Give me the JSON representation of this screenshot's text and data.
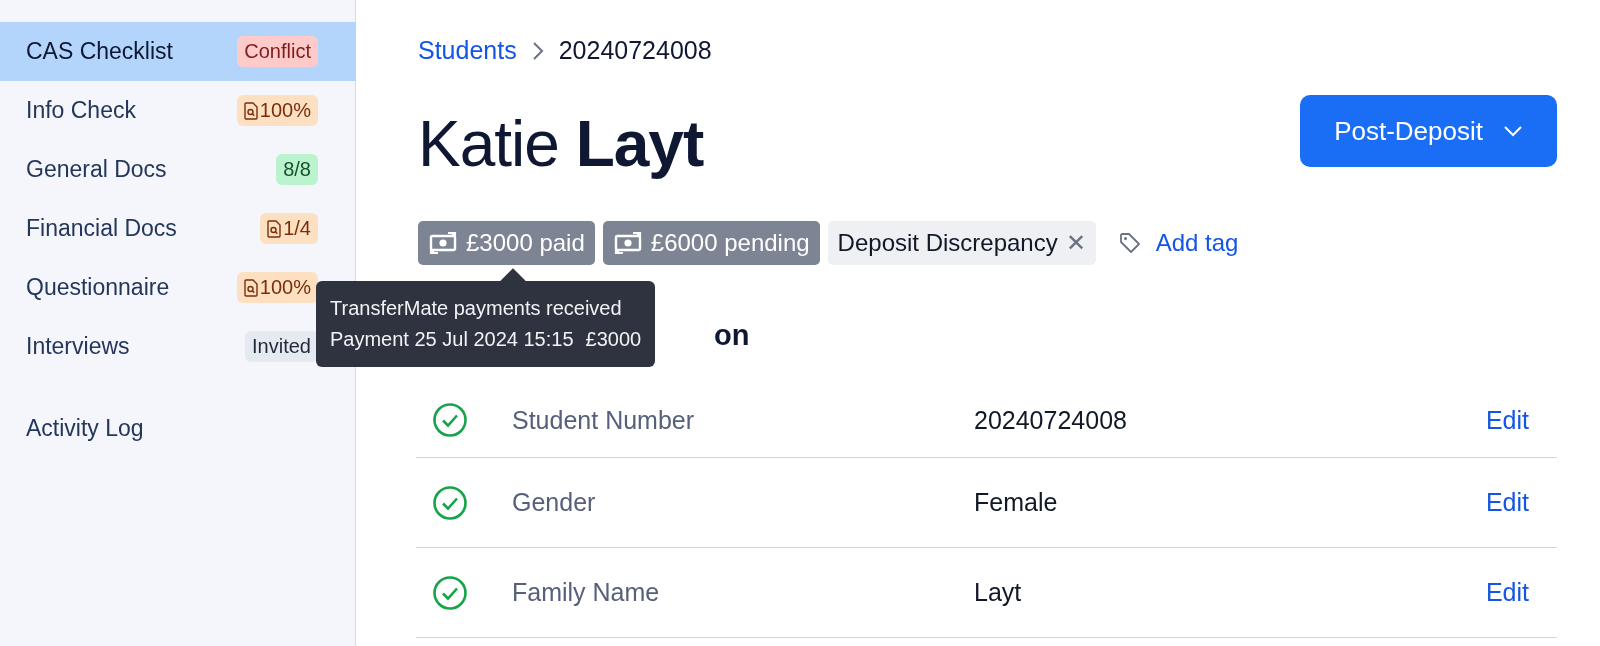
{
  "sidebar": {
    "items": [
      {
        "label": "CAS Checklist",
        "selected": true,
        "badge": {
          "kind": "danger",
          "text": "Conflict"
        }
      },
      {
        "label": "Info Check",
        "selected": false,
        "badge": {
          "kind": "warning_doc",
          "text": "100%"
        }
      },
      {
        "label": "General Docs",
        "selected": false,
        "badge": {
          "kind": "success",
          "text": "8/8"
        }
      },
      {
        "label": "Financial Docs",
        "selected": false,
        "badge": {
          "kind": "warning_doc",
          "text": "1/4"
        }
      },
      {
        "label": "Questionnaire",
        "selected": false,
        "badge": {
          "kind": "warning_doc",
          "text": "100%"
        }
      },
      {
        "label": "Interviews",
        "selected": false,
        "badge": {
          "kind": "neutral",
          "text": "Invited"
        }
      }
    ],
    "footer_item": {
      "label": "Activity Log"
    }
  },
  "breadcrumb": [
    {
      "label": "Students",
      "kind": "link"
    },
    {
      "label": "20240724008",
      "kind": "current"
    }
  ],
  "title": {
    "first": "Katie",
    "last": "Layt"
  },
  "status_button": {
    "label": "Post-Deposit"
  },
  "tags": [
    {
      "kind": "payment",
      "text": "£3000 paid"
    },
    {
      "kind": "payment",
      "text": "£6000 pending"
    },
    {
      "kind": "label",
      "text": "Deposit Discrepancy",
      "remove_icon": "✕"
    }
  ],
  "add_tag": {
    "label": "Add tag"
  },
  "tooltip": {
    "title": "TransferMate payments received",
    "lines": [
      {
        "label": "Payment 25 Jul 2024 15:15",
        "amount": "£3000"
      }
    ]
  },
  "section_heading": "on",
  "rows": [
    {
      "verified": true,
      "label": "Student Number",
      "value": "20240724008",
      "action": "Edit"
    },
    {
      "verified": true,
      "label": "Gender",
      "value": "Female",
      "action": "Edit"
    },
    {
      "verified": true,
      "label": "Family Name",
      "value": "Layt",
      "action": "Edit"
    }
  ]
}
